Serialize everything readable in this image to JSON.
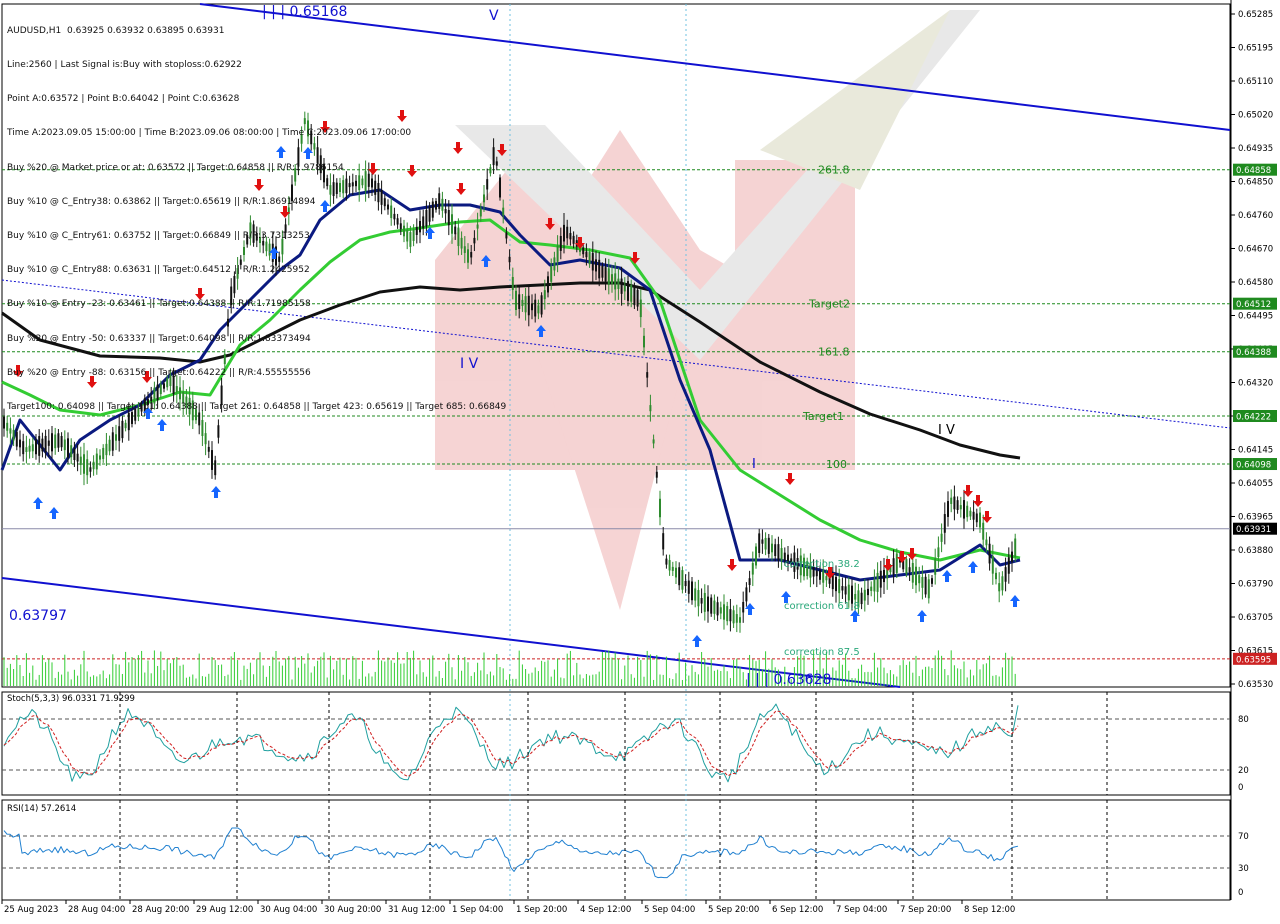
{
  "header": {
    "symbol": "AUDUSD,H1",
    "ohlc": "0.63925 0.63932 0.63895 0.63931",
    "info_lines": [
      "Line:2560 | Last Signal is:Buy with stoploss:0.62922",
      "Point A:0.63572 | Point B:0.64042 | Point C:0.63628",
      "Time A:2023.09.05 15:00:00 | Time B:2023.09.06 08:00:00 | Time C:2023.09.06 17:00:00",
      "Buy %20 @ Market price or at: 0.63572 || Target:0.64858 || R/R:1.9786154",
      "Buy %10 @ C_Entry38: 0.63862 || Target:0.65619 || R/R:1.86914894",
      "Buy %10 @ C_Entry61: 0.63752 || Target:0.66849 || R/R:3.7313253",
      "Buy %10 @ C_Entry88: 0.63631 || Target:0.64512 || R/R:1.2425952",
      "Buy %10 @ Entry -23: 0.63461 || Target:0.64388 || R/R:1.71985158",
      "Buy %20 @ Entry -50: 0.63337 || Target:0.64098 || R/R:1.83373494",
      "Buy %20 @ Entry -88: 0.63156 || Target:0.64222 || R/R:4.55555556",
      "Target100: 0.64098 || Target 161: 0.64388 || Target 261: 0.64858 || Target 423: 0.65619 || Target 685: 0.66849"
    ]
  },
  "chart_data": {
    "type": "candlestick",
    "price_range": [
      0.6353,
      0.6526
    ],
    "price_ticks": [
      "0.65285",
      "0.65195",
      "0.65110",
      "0.65020",
      "0.64935",
      "0.64850",
      "0.64760",
      "0.64670",
      "0.64580",
      "0.64495",
      "0.64405",
      "0.64320",
      "0.64230",
      "0.64145",
      "0.64055",
      "0.63965",
      "0.63880",
      "0.63790",
      "0.63705",
      "0.63615",
      "0.63530"
    ],
    "x_ticks": [
      "25 Aug 2023",
      "28 Aug 04:00",
      "28 Aug 20:00",
      "29 Aug 12:00",
      "30 Aug 04:00",
      "30 Aug 20:00",
      "31 Aug 12:00",
      "1 Sep 04:00",
      "1 Sep 20:00",
      "4 Sep 12:00",
      "5 Sep 04:00",
      "5 Sep 20:00",
      "6 Sep 12:00",
      "7 Sep 04:00",
      "7 Sep 20:00",
      "8 Sep 12:00"
    ],
    "current_price": "0.63931",
    "horizontal_levels": [
      {
        "price": 0.64858,
        "tag": "0.64858",
        "label": "261.8",
        "kind": "target"
      },
      {
        "price": 0.64512,
        "tag": "0.64512",
        "label": "Target2",
        "kind": "target"
      },
      {
        "price": 0.64388,
        "tag": "0.64388",
        "label": "161.8",
        "kind": "target"
      },
      {
        "price": 0.64222,
        "tag": "0.64222",
        "label": "Target1",
        "kind": "target"
      },
      {
        "price": 0.64098,
        "tag": "0.64098",
        "label": "100",
        "kind": "target"
      },
      {
        "price": 0.63595,
        "tag": "0.63595",
        "label": "",
        "kind": "stop"
      }
    ],
    "correction_labels": [
      "correction 38.2",
      "correction 61.8",
      "correction 87.5"
    ],
    "wave_labels": {
      "top_left": "| | | 0.65168",
      "v": "V",
      "iv": "I V",
      "bottom_value": "0.63797",
      "bottom_right": "| | | 0.63628",
      "i": "I",
      "iv_right": "I V"
    },
    "indicators": {
      "stoch": {
        "label": "Stoch(5,3,3) 96.0331 71.9299",
        "levels": [
          "80",
          "20",
          "0"
        ],
        "k": 96.0331,
        "d": 71.9299
      },
      "rsi": {
        "label": "RSI(14) 57.2614",
        "levels": [
          "70",
          "30",
          "0"
        ],
        "value": 57.2614
      }
    }
  },
  "colors": {
    "bull_candle": "#2e8b2e",
    "bear_candle": "#111111",
    "ma_fast": "#0b1a80",
    "ma_mid": "#33cc33",
    "ma_slow": "#111111",
    "channel": "#1010d0",
    "target_line": "#1f8a1f",
    "stop_line": "#cc2222",
    "buy_arrow": "#1565ff",
    "sell_arrow": "#e01010",
    "stoch_main": "#20a0a0",
    "stoch_signal": "#d02020",
    "rsi_line": "#2080d0"
  }
}
